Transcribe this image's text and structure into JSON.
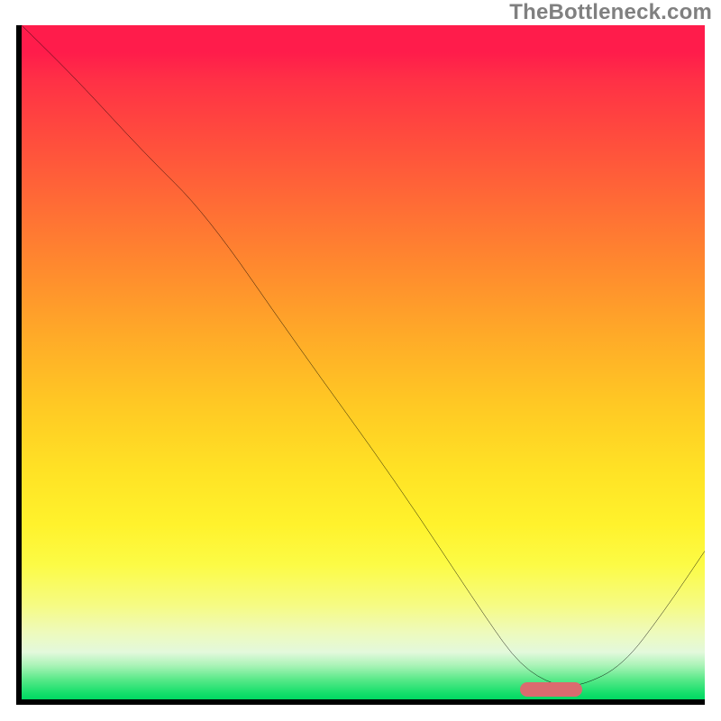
{
  "watermark": "TheBottleneck.com",
  "colors": {
    "axis": "#000000",
    "curve": "#000000",
    "marker": "#db6b6f",
    "watermark": "#808080"
  },
  "chart_data": {
    "type": "line",
    "title": "",
    "xlabel": "",
    "ylabel": "",
    "xlim": [
      0,
      100
    ],
    "ylim": [
      0,
      100
    ],
    "grid": false,
    "series": [
      {
        "name": "bottleneck-curve",
        "x": [
          0,
          8,
          18,
          27,
          40,
          55,
          68,
          73,
          78,
          82,
          88,
          94,
          100
        ],
        "values": [
          100,
          92,
          81,
          72,
          53,
          32,
          12,
          5,
          2,
          2,
          5,
          13,
          22
        ]
      }
    ],
    "annotations": [
      {
        "name": "optimal-range-marker",
        "x_start": 73,
        "x_end": 82,
        "y": 1.5,
        "color": "#db6b6f"
      }
    ],
    "background": {
      "type": "vertical-gradient",
      "stops": [
        {
          "pos": 0.0,
          "color": "#ff1c4b"
        },
        {
          "pos": 0.5,
          "color": "#ffc020"
        },
        {
          "pos": 0.8,
          "color": "#fcfb45"
        },
        {
          "pos": 1.0,
          "color": "#00d862"
        }
      ]
    }
  }
}
